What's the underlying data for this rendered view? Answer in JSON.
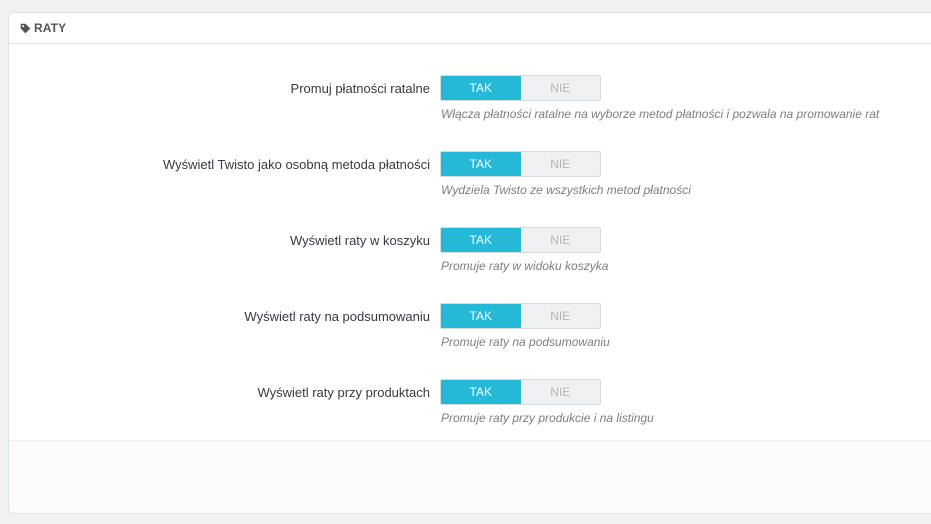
{
  "panel": {
    "title": "RATY",
    "icon": "tag-icon"
  },
  "settings": [
    {
      "label": "Promuj płatności ratalne",
      "yes_label": "TAK",
      "no_label": "NIE",
      "selected": "TAK",
      "help": "Włącza płatności ratalne na wyborze metod płatności i pozwala na promowanie rat"
    },
    {
      "label": "Wyświetl Twisto jako osobną metoda płatności",
      "yes_label": "TAK",
      "no_label": "NIE",
      "selected": "TAK",
      "help": "Wydziela Twisto ze wszystkich metod płatności"
    },
    {
      "label": "Wyświetl raty w koszyku",
      "yes_label": "TAK",
      "no_label": "NIE",
      "selected": "TAK",
      "help": "Promuje raty w widoku koszyka"
    },
    {
      "label": "Wyświetl raty na podsumowaniu",
      "yes_label": "TAK",
      "no_label": "NIE",
      "selected": "TAK",
      "help": "Promuje raty na podsumowaniu"
    },
    {
      "label": "Wyświetl raty przy produktach",
      "yes_label": "TAK",
      "no_label": "NIE",
      "selected": "TAK",
      "help": "Promuje raty przy produkcie i na listingu"
    }
  ],
  "colors": {
    "accent": "#25b9d7",
    "switch_off_bg": "#eef0f1",
    "help_text": "#7a7f84"
  }
}
